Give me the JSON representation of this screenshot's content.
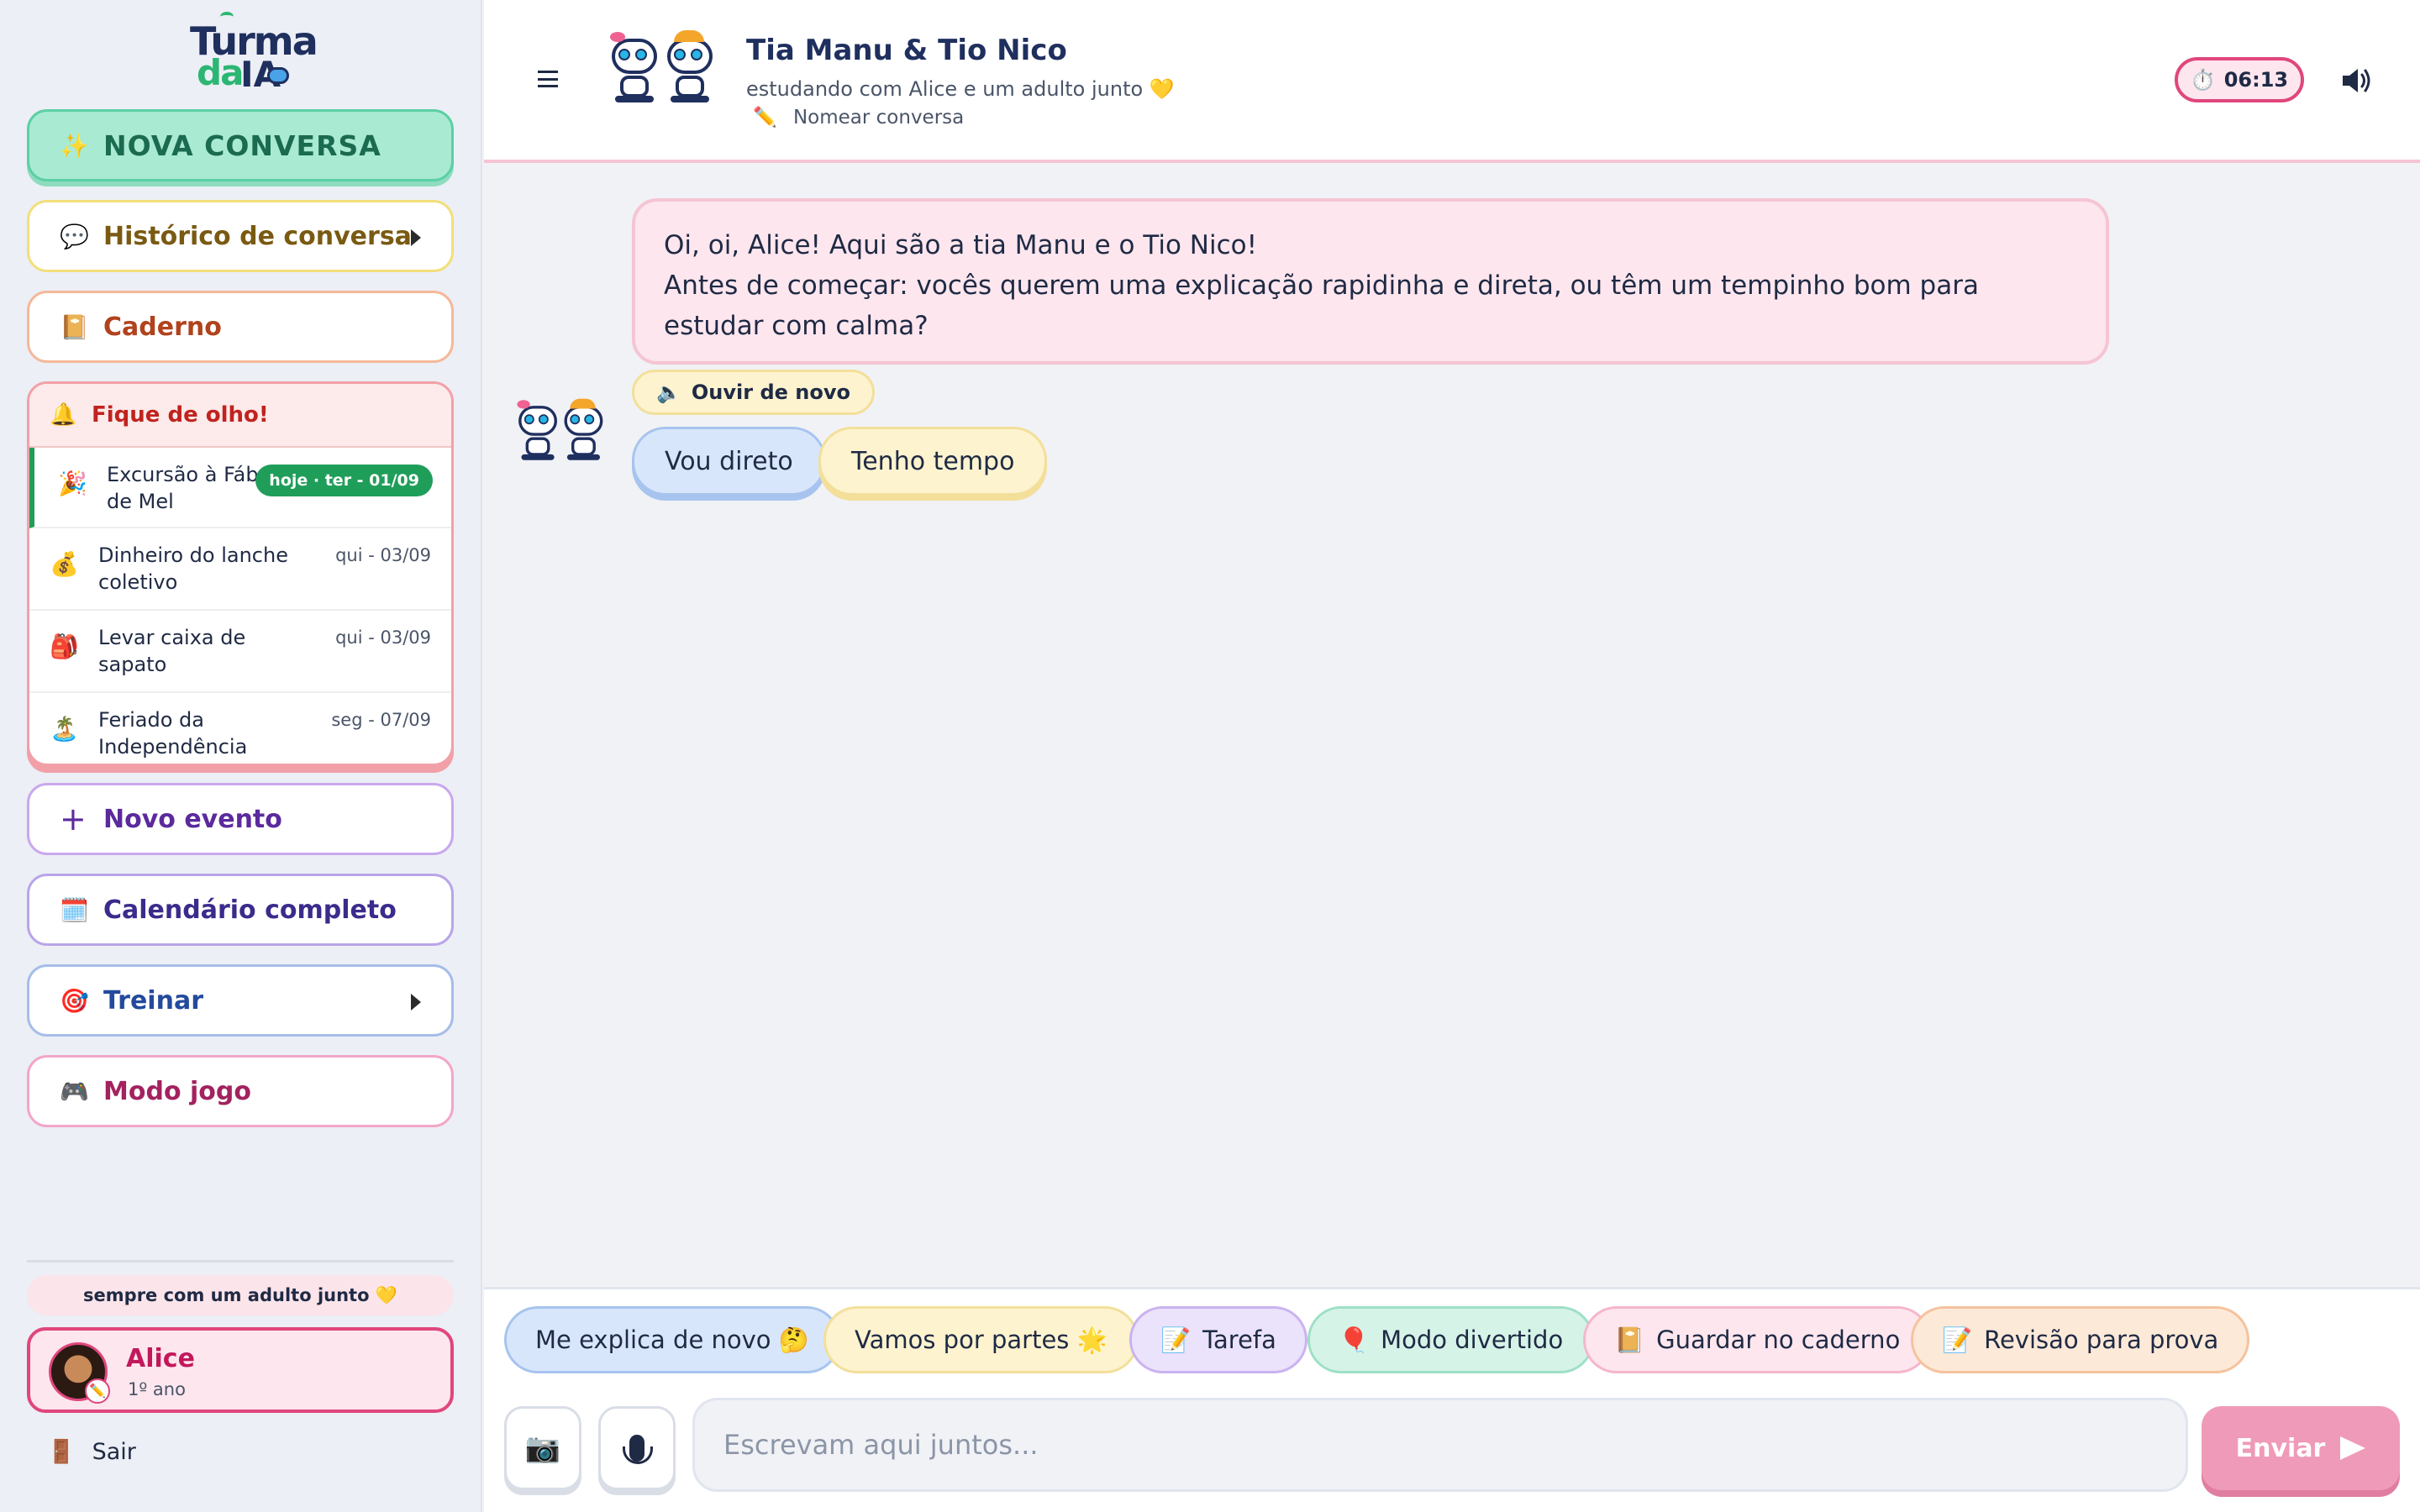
{
  "app": {
    "logo_line1": "Turma",
    "logo_line2": "da",
    "logo_line3": "IA"
  },
  "sidebar": {
    "new_chat": {
      "icon": "✨",
      "label": "NOVA CONVERSA"
    },
    "history": {
      "icon": "💬",
      "label": "Histórico de conversa"
    },
    "notebook": {
      "icon": "📔",
      "label": "Caderno"
    },
    "alerts": {
      "icon": "🔔",
      "title": "Fique de olho!",
      "events": [
        {
          "icon": "🎉",
          "label": "Excursão à Fábrica de Mel",
          "date": "hoje · ter - 01/09",
          "today": true
        },
        {
          "icon": "💰",
          "label": "Dinheiro do lanche coletivo",
          "date": "qui - 03/09",
          "today": false
        },
        {
          "icon": "🎒",
          "label": "Levar caixa de sapato",
          "date": "qui - 03/09",
          "today": false
        },
        {
          "icon": "🏝️",
          "label": "Feriado da Independência",
          "date": "seg - 07/09",
          "today": false
        }
      ]
    },
    "new_event": {
      "icon": "+",
      "label": "Novo evento"
    },
    "calendar": {
      "icon": "🗓️",
      "label": "Calendário completo"
    },
    "train": {
      "icon": "🎯",
      "label": "Treinar"
    },
    "game": {
      "icon": "🎮",
      "label": "Modo jogo"
    },
    "adult_note": "sempre com um adulto junto 💛",
    "user": {
      "name": "Alice",
      "grade": "1º ano"
    },
    "logout": {
      "icon": "🚪",
      "label": "Sair"
    }
  },
  "header": {
    "title": "Tia Manu & Tio Nico",
    "subtitle": "estudando com Alice e um adulto junto 💛",
    "rename": {
      "icon": "✏️",
      "label": "Nomear conversa"
    },
    "timer": {
      "icon": "⏱️",
      "value": "06:13"
    }
  },
  "chat": {
    "message_line1": "Oi, oi, Alice! Aqui são a tia Manu e o Tio Nico!",
    "message_line2": "Antes de começar: vocês querem uma explicação rapidinha e direta, ou têm um tempinho bom para estudar com calma?",
    "listen_again": {
      "icon": "🔈",
      "label": "Ouvir de novo"
    },
    "choices": [
      "Vou direto",
      "Tenho tempo"
    ]
  },
  "quick_actions": [
    {
      "label": "Me explica de novo 🤔",
      "icon": ""
    },
    {
      "label": "Vamos por partes 🌟",
      "icon": ""
    },
    {
      "label": "Tarefa",
      "icon": "📝"
    },
    {
      "label": "Modo divertido",
      "icon": "🎈"
    },
    {
      "label": "Guardar no caderno",
      "icon": "📔"
    },
    {
      "label": "Revisão para prova",
      "icon": "📝"
    }
  ],
  "composer": {
    "camera_icon": "📷",
    "placeholder": "Escrevam aqui juntos...",
    "send_label": "Enviar"
  }
}
